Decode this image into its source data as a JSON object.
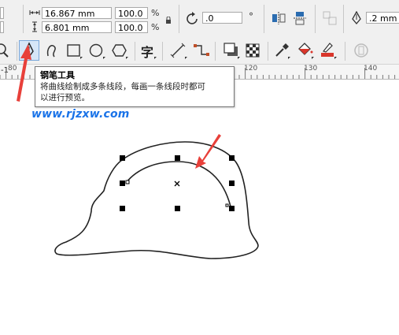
{
  "property_bar": {
    "size_width": "16.867 mm",
    "size_height": "6.801 mm",
    "scale_x": "100.0",
    "scale_y": "100.0",
    "percent_symbol": "%",
    "rotation": ".0",
    "degree_symbol": "°",
    "outline_width": ".2 mm"
  },
  "toolbar": {
    "tools": [
      {
        "name": "zoom-tool"
      },
      {
        "name": "pen-tool",
        "active": true
      },
      {
        "name": "bspline-tool"
      },
      {
        "name": "rectangle-tool"
      },
      {
        "name": "ellipse-tool"
      },
      {
        "name": "polygon-tool"
      },
      {
        "name": "text-tool",
        "glyph": "字"
      },
      {
        "name": "parallel-dimension-tool"
      },
      {
        "name": "connector-tool"
      },
      {
        "name": "drop-shadow-tool"
      },
      {
        "name": "transparency-tool"
      },
      {
        "name": "eyedropper-tool"
      },
      {
        "name": "fill-tool"
      },
      {
        "name": "smart-fill-tool"
      },
      {
        "name": "outline-tool"
      }
    ]
  },
  "ruler": {
    "doc_tab_text": "-1",
    "ticks": [
      "80",
      "120",
      "130",
      "140"
    ]
  },
  "tooltip": {
    "title": "钢笔工具",
    "description_line1": "将曲线绘制成多条线段，每画一条线段时都可",
    "description_line2": "以进行预览。"
  },
  "watermark": "www.rjzxw.com",
  "colors": {
    "accent_arrow": "#e8403a",
    "active_tool_border": "#7aa7d9",
    "active_tool_bg": "#d6e6f7",
    "watermark": "#1a73e8"
  }
}
